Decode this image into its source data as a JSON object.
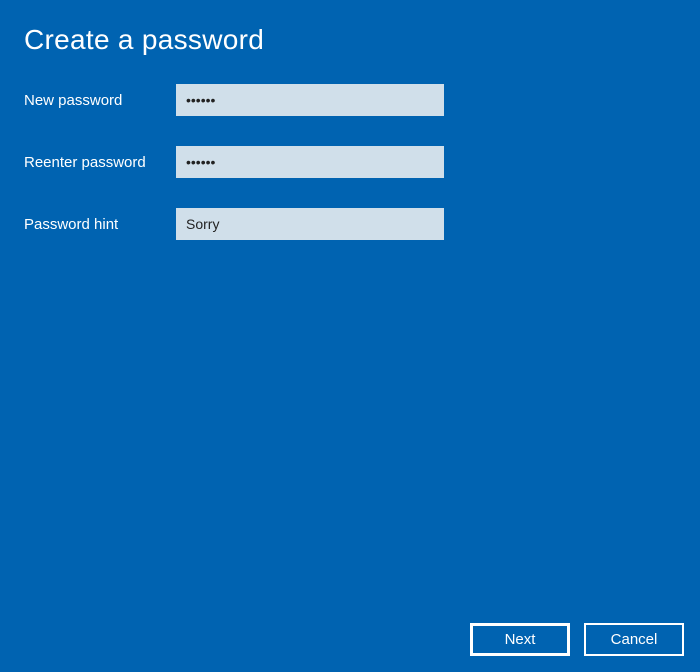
{
  "title": "Create a password",
  "fields": {
    "new_password": {
      "label": "New password",
      "value": "••••••"
    },
    "reenter_password": {
      "label": "Reenter password",
      "value": "••••••"
    },
    "password_hint": {
      "label": "Password hint",
      "value": "Sorry"
    }
  },
  "buttons": {
    "next": "Next",
    "cancel": "Cancel"
  }
}
